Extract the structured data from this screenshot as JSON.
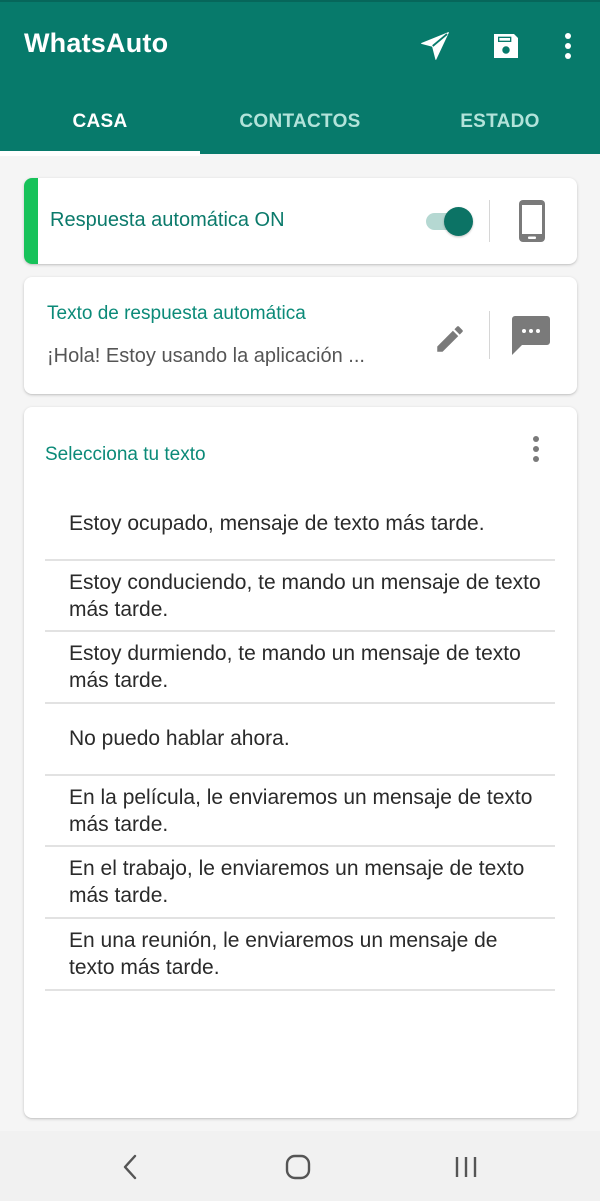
{
  "app": {
    "title": "WhatsAuto",
    "actions": [
      {
        "name": "send-icon",
        "label": "Send"
      },
      {
        "name": "save-icon",
        "label": "Save"
      },
      {
        "name": "more-vert-icon",
        "label": "More options"
      }
    ]
  },
  "tabs": [
    {
      "label": "CASA",
      "active": true
    },
    {
      "label": "CONTACTOS",
      "active": false
    },
    {
      "label": "ESTADO",
      "active": false
    }
  ],
  "auto_reply": {
    "label": "Respuesta automática ON",
    "enabled": true,
    "accent_color": "#17c25a",
    "device_icon": "phone-icon"
  },
  "reply_text": {
    "title": "Texto de respuesta automática",
    "value": "¡Hola! Estoy usando la aplicación ...",
    "edit_icon": "pencil-icon",
    "message_icon": "chat-bubble-icon"
  },
  "select_text": {
    "title": "Selecciona tu texto",
    "menu_icon": "more-vert-icon",
    "messages": [
      "Estoy ocupado, mensaje de texto más tarde.",
      "Estoy conduciendo, te mando un mensaje de texto más tarde.",
      "Estoy durmiendo, te mando un mensaje de texto más tarde.",
      "No puedo hablar ahora.",
      "En la película, le enviaremos un mensaje de texto más tarde.",
      "En el trabajo, le enviaremos un mensaje de texto más tarde.",
      "En una reunión, le enviaremos un mensaje de texto más tarde."
    ]
  },
  "colors": {
    "primary": "#077a6b",
    "accent_text": "#0b8a78",
    "toggle_thumb": "#0c7365"
  },
  "navbar": {
    "buttons": [
      "back-icon",
      "home-icon",
      "recents-icon"
    ]
  }
}
